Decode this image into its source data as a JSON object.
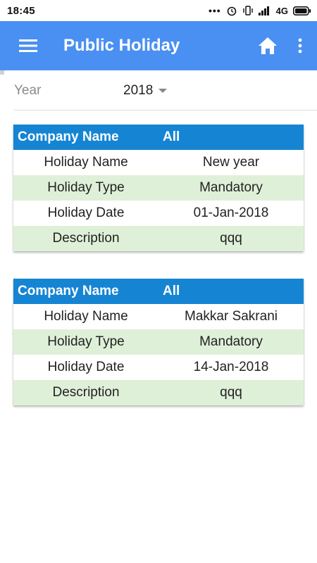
{
  "status_bar": {
    "time": "18:45",
    "network": "4G",
    "icons": [
      "more-dots-icon",
      "alarm-icon",
      "vibrate-icon",
      "signal-icon",
      "battery-icon"
    ]
  },
  "app_bar": {
    "title": "Public Holiday",
    "icons": [
      "menu-icon",
      "home-icon",
      "overflow-menu-icon"
    ],
    "color": "#4a90f2"
  },
  "filter": {
    "year_label": "Year",
    "year_value": "2018"
  },
  "holidays": [
    {
      "company_label": "Company Name",
      "company_value": "All",
      "rows": [
        {
          "label": "Holiday Name",
          "value": "New year"
        },
        {
          "label": "Holiday Type",
          "value": "Mandatory"
        },
        {
          "label": "Holiday Date",
          "value": "01-Jan-2018"
        },
        {
          "label": "Description",
          "value": "qqq"
        }
      ]
    },
    {
      "company_label": "Company Name",
      "company_value": "All",
      "rows": [
        {
          "label": "Holiday Name",
          "value": "Makkar Sakrani"
        },
        {
          "label": "Holiday Type",
          "value": "Mandatory"
        },
        {
          "label": "Holiday Date",
          "value": "14-Jan-2018"
        },
        {
          "label": "Description",
          "value": "qqq"
        }
      ]
    }
  ],
  "colors": {
    "card_header": "#1585d3",
    "alt_row": "#dff0d8"
  }
}
